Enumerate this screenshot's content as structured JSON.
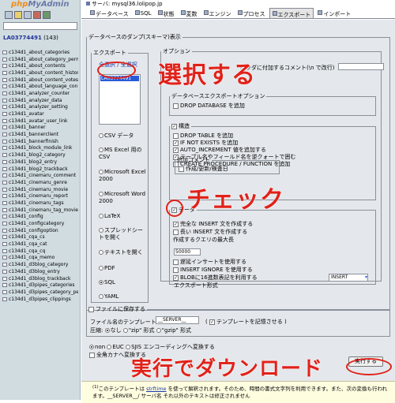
{
  "sidebar": {
    "logo": "phpMyAdmin",
    "db_name": "LA03774491",
    "db_count": "(143)",
    "tables": [
      "c134d1_about_categories",
      "c134d1_about_category_perm",
      "c134d1_about_contents",
      "c134d1_about_content_history",
      "c134d1_about_content_votes",
      "c134d1_about_language_con",
      "c134d1_analyzer_counter",
      "c134d1_analyzer_data",
      "c134d1_analyzer_setting",
      "c134d1_avatar",
      "c134d1_avatar_user_link",
      "c134d1_banner",
      "c134d1_bannerclient",
      "c134d1_bannerfinish",
      "c134d1_block_module_link",
      "c134d1_blog2_category",
      "c134d1_blog2_entry",
      "c134d1_blog2_trackback",
      "c134d1_cinemaru_comment",
      "c134d1_cinemaru_genre",
      "c134d1_cinemaru_movie",
      "c134d1_cinemaru_report",
      "c134d1_cinemaru_tags",
      "c134d1_cinemaru_tag_movie",
      "c134d1_config",
      "c134d1_configcategory",
      "c134d1_configoption",
      "c134d1_cqa_cs",
      "c134d1_cqa_cat",
      "c134d1_cqa_cq",
      "c134d1_cqa_memo",
      "c134d1_d3blog_category",
      "c134d1_d3blog_entry",
      "c134d1_d3blog_trackback",
      "c134d1_d3pipes_categories",
      "c134d1_d3pipes_category_pe",
      "c134d1_d3pipes_clippings"
    ]
  },
  "server_bar": "サーバ: mysql36.lolipop.jp",
  "tabs": [
    "データベース",
    "SQL",
    "状態",
    "変数",
    "エンジン",
    "プロセス",
    "エクスポート",
    "インポート"
  ],
  "dump_legend": "データベースのダンプ(スキーマ)表示",
  "export": {
    "legend": "エクスポート",
    "select_all": "全選択 / 全選択",
    "selected_table": "LA03774491",
    "formats": [
      "CSV データ",
      "MS Excel 用の CSV",
      "Microsoft Excel 2000",
      "Microsoft Word 2000",
      "LaTeX",
      "スプレッドシートを開く",
      "テキストを開く",
      "PDF",
      "SQL",
      "YAML"
    ]
  },
  "options": {
    "legend": "オプション",
    "line1": "ヘッダに付加するコメント(\\n で改行)",
    "sql_legend": "データベースエクスポートオプション",
    "drop_db": "DROP DATABASE を追加",
    "struct_legend": "構造",
    "struct_items": [
      "DROP TABLE を追加",
      "IF NOT EXISTS を追加",
      "AUTO_INCREMENT 値を追加する",
      "テーブル名やフィールド名を逆クォートで囲む",
      "CREATE PROCEDURE / FUNCTION を追加"
    ],
    "comment_legend": "追加コメント",
    "comment_item": "作成/更新/検査日",
    "data_legend": "データ",
    "data_items": [
      "完全な INSERT 文を作成する",
      "長い INSERT 文を作成する"
    ],
    "limit_label": "作成するクエリの最大長",
    "limit_value": "50000",
    "data_items2": [
      "遅延インサートを使用する",
      "INSERT IGNORE を使用する",
      "BLOBに16進数表記を利用する"
    ],
    "export_type_label": "エクスポート形式",
    "export_type_value": "INSERT"
  },
  "save": {
    "legend": "ファイルに保存する",
    "template_label": "ファイル名のテンプレート",
    "template_value": "__SERVER__",
    "remember": "テンプレートを記憶させる",
    "compress_label": "圧縮:",
    "compress_options": [
      "なし",
      "\"zip\" 形式",
      "\"gzip\" 形式"
    ]
  },
  "charset": {
    "options": [
      "non",
      "EUC",
      "SJIS",
      "エンコーディングへ変換する"
    ],
    "kana": "全角カナへ変換する"
  },
  "run_button": "実行する",
  "note": {
    "prefix": "このテンプレートは",
    "link": "strftime",
    "text": "を使って解釈されます。そのため、時間の書式文字列を利用できます。また、次の変換も行われます。__SERVER__/ サーバ名 それ以外のテキストは修正されません"
  },
  "annotations": {
    "select": "選択する",
    "check": "チェック",
    "run": "実行でダウンロード"
  }
}
